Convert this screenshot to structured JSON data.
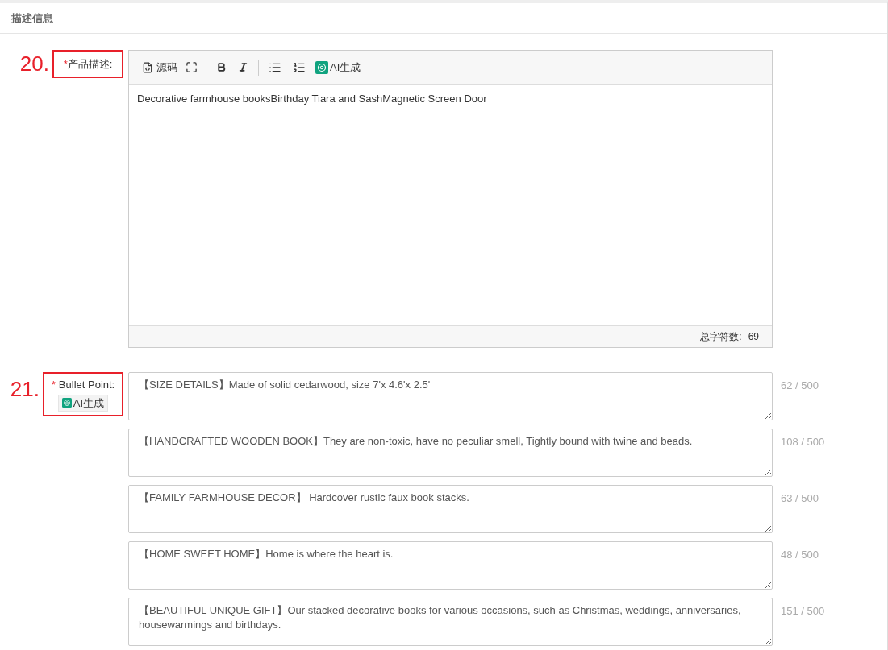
{
  "section": {
    "title": "描述信息"
  },
  "description": {
    "annotation": "20.",
    "required_mark": "*",
    "label": "产品描述:",
    "toolbar": [
      {
        "kind": "source",
        "label": "源码"
      },
      {
        "kind": "fullscreen"
      },
      {
        "kind": "separator"
      },
      {
        "kind": "bold"
      },
      {
        "kind": "italic"
      },
      {
        "kind": "separator"
      },
      {
        "kind": "bullets"
      },
      {
        "kind": "numbers"
      },
      {
        "kind": "ai",
        "label": "AI生成"
      }
    ],
    "content": "Decorative farmhouse booksBirthday Tiara and SashMagnetic Screen Door",
    "count_label": "总字符数:",
    "count": "69"
  },
  "bullets": {
    "annotation": "21.",
    "required_mark": "*",
    "label": "Bullet Point:",
    "ai_button": "AI生成",
    "items": [
      {
        "text": "【SIZE DETAILS】Made of solid cedarwood, size 7'x 4.6'x 2.5'",
        "count": "62 / 500"
      },
      {
        "text": "【HANDCRAFTED WOODEN BOOK】They are non-toxic, have no peculiar smell, Tightly bound with twine and beads.",
        "count": "108 / 500"
      },
      {
        "text": "【FAMILY FARMHOUSE DECOR】 Hardcover rustic faux book stacks.",
        "count": "63 / 500"
      },
      {
        "text": "【HOME SWEET HOME】Home is where the heart is.",
        "count": "48 / 500"
      },
      {
        "text": "【BEAUTIFUL UNIQUE GIFT】Our stacked decorative books for various occasions, such as Christmas, weddings, anniversaries, housewarmings and birthdays.",
        "count": "151 / 500"
      }
    ]
  }
}
